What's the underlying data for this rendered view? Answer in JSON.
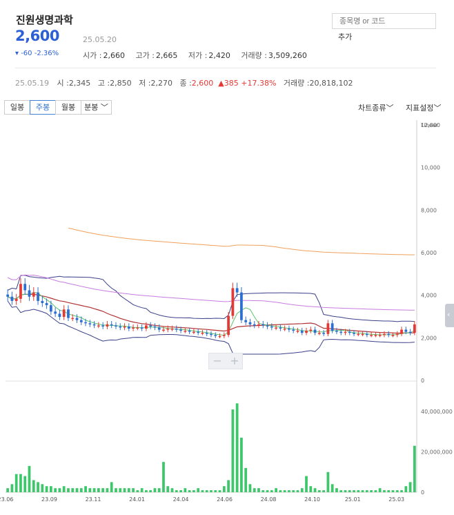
{
  "stock": {
    "name": "진원생명과학",
    "price": "2,600",
    "date": "25.05.20",
    "change": "▾ -60  -2.36%",
    "open_label": "시가 :",
    "open": "2,660",
    "high_label": "고가 :",
    "high": "2,665",
    "low_label": "저가 :",
    "low": "2,420",
    "volume_label": "거래량 :",
    "volume": "3,509,260"
  },
  "search": {
    "placeholder": "종목명 or 코드",
    "add_label": "추가"
  },
  "previous": {
    "date": "25.05.19",
    "open_label": "시 :",
    "open": "2,345",
    "high_label": "고 :",
    "high": "2,850",
    "low_label": "저 :",
    "low": "2,270",
    "close_label": "종 :",
    "close": "2,600",
    "change": "▲385 +17.38%",
    "volume_label": "거래량 :",
    "volume": "20,818,102"
  },
  "toolbar": {
    "period_buttons": [
      "일봉",
      "주봉",
      "월봉",
      "분봉 ﹀"
    ],
    "active_index": 1,
    "chart_type": "차트종류﹀",
    "indicator": "지표설정﹀"
  },
  "zoom": {
    "minus": "−",
    "plus": "+"
  },
  "colors": {
    "up": "#e53935",
    "down": "#2c6fd1",
    "volume": "#3ec76a",
    "ma_orange": "#f0a05a",
    "ma_purple": "#c77be0",
    "ma_red": "#b03030",
    "ma_green": "#58c46a",
    "bollinger": "#3a3f8a"
  },
  "chart_data": {
    "type": "candlestick",
    "scale": "Linear",
    "y_ticks": [
      "12,000",
      "10,000",
      "8,000",
      "6,000",
      "4,000",
      "2,000",
      "0"
    ],
    "ylim": [
      0,
      12000
    ],
    "volume_ticks": [
      "40,000,000",
      "20,000,000",
      "0"
    ],
    "volume_lim": [
      0,
      40000000
    ],
    "x_ticks": [
      "23.06",
      "23.09",
      "23.11",
      "24.01",
      "24.04",
      "24.06",
      "24.08",
      "24.10",
      "25.01",
      "25.03"
    ],
    "close": [
      3900,
      3700,
      3800,
      4500,
      4200,
      3900,
      4100,
      3700,
      3600,
      3500,
      3200,
      3100,
      2950,
      3300,
      2900,
      2900,
      2800,
      2700,
      2650,
      2600,
      2550,
      2550,
      2500,
      2600,
      2550,
      2500,
      2450,
      2500,
      2400,
      2450,
      2450,
      2400,
      2550,
      2500,
      2450,
      2350,
      2350,
      2400,
      2400,
      2350,
      2300,
      2300,
      2250,
      2250,
      2200,
      2200,
      2150,
      2100,
      2050,
      2050,
      2100,
      3000,
      4300,
      4100,
      2800,
      2700,
      2600,
      2550,
      2600,
      2550,
      2500,
      2450,
      2450,
      2400,
      2400,
      2350,
      2300,
      2300,
      2200,
      2300,
      2350,
      2200,
      2200,
      2150,
      2650,
      2300,
      2250,
      2200,
      2250,
      2200,
      2150,
      2150,
      2150,
      2100,
      2100,
      2100,
      2100,
      2150,
      2100,
      2100,
      2150,
      2350,
      2250,
      2200,
      2600
    ],
    "volume": [
      2,
      4,
      9,
      9,
      8,
      13,
      6,
      5,
      4,
      3,
      3,
      2,
      2,
      3,
      2,
      2,
      2,
      2,
      3,
      2,
      2,
      2,
      2,
      2,
      5,
      2,
      2,
      2,
      2,
      2,
      1,
      2,
      1,
      1,
      2,
      2,
      15,
      3,
      2,
      1,
      1,
      2,
      1,
      1,
      2,
      1,
      1,
      1,
      1,
      1,
      3,
      6,
      41,
      44,
      27,
      12,
      4,
      2,
      2,
      1,
      1,
      1,
      2,
      1,
      1,
      1,
      1,
      1,
      2,
      8,
      3,
      2,
      1,
      1,
      10,
      4,
      2,
      1,
      1,
      1,
      1,
      1,
      1,
      1,
      1,
      1,
      2,
      1,
      1,
      1,
      1,
      1,
      3,
      5,
      23
    ]
  }
}
